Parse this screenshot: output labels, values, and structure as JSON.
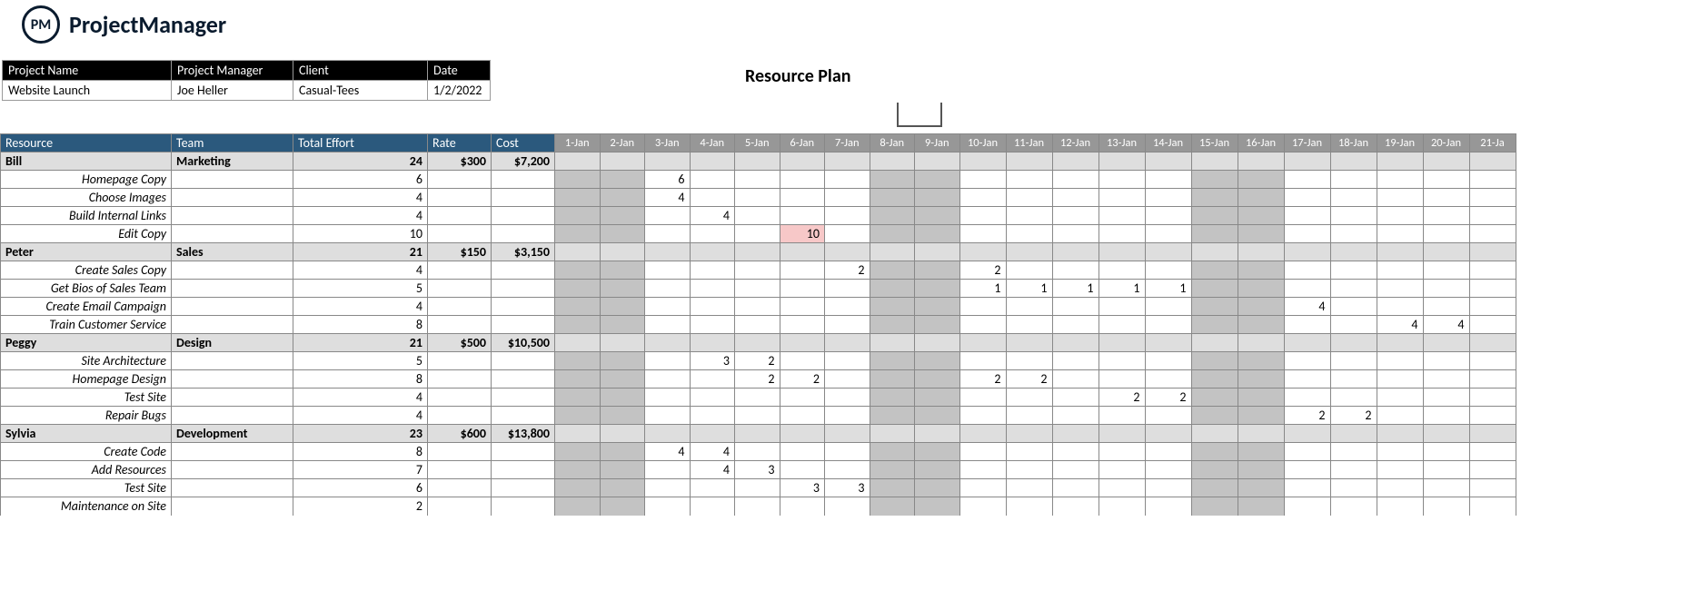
{
  "brand": {
    "short": "PM",
    "name": "ProjectManager"
  },
  "title": "Resource Plan",
  "meta": {
    "headers": [
      "Project Name",
      "Project Manager",
      "Client",
      "Date"
    ],
    "values": [
      "Website Launch",
      "Joe Heller",
      "Casual-Tees",
      "1/2/2022"
    ]
  },
  "columns_left": [
    "Resource",
    "Team",
    "Total Effort",
    "Rate",
    "Cost"
  ],
  "dates": [
    "1-Jan",
    "2-Jan",
    "3-Jan",
    "4-Jan",
    "5-Jan",
    "6-Jan",
    "7-Jan",
    "8-Jan",
    "9-Jan",
    "10-Jan",
    "11-Jan",
    "12-Jan",
    "13-Jan",
    "14-Jan",
    "15-Jan",
    "16-Jan",
    "17-Jan",
    "18-Jan",
    "19-Jan",
    "20-Jan",
    "21-Ja"
  ],
  "weekend_cols": [
    0,
    1,
    7,
    8,
    14,
    15
  ],
  "groups": [
    {
      "resource": "Bill",
      "team": "Marketing",
      "effort": "24",
      "rate": "$300",
      "cost": "$7,200",
      "tasks": [
        {
          "name": "Homepage Copy",
          "effort": "6",
          "cells": {
            "2": "6"
          }
        },
        {
          "name": "Choose Images",
          "effort": "4",
          "cells": {
            "2": "4"
          }
        },
        {
          "name": "Build Internal Links",
          "effort": "4",
          "cells": {
            "3": "4"
          }
        },
        {
          "name": "Edit Copy",
          "effort": "10",
          "cells": {
            "5": "10"
          },
          "warn": [
            5
          ]
        }
      ]
    },
    {
      "resource": "Peter",
      "team": "Sales",
      "effort": "21",
      "rate": "$150",
      "cost": "$3,150",
      "tasks": [
        {
          "name": "Create Sales Copy",
          "effort": "4",
          "cells": {
            "6": "2",
            "9": "2"
          }
        },
        {
          "name": "Get Bios of Sales Team",
          "effort": "5",
          "cells": {
            "9": "1",
            "10": "1",
            "11": "1",
            "12": "1",
            "13": "1"
          }
        },
        {
          "name": "Create Email Campaign",
          "effort": "4",
          "cells": {
            "16": "4"
          }
        },
        {
          "name": "Train Customer Service",
          "effort": "8",
          "cells": {
            "18": "4",
            "19": "4"
          }
        }
      ]
    },
    {
      "resource": "Peggy",
      "team": "Design",
      "effort": "21",
      "rate": "$500",
      "cost": "$10,500",
      "tasks": [
        {
          "name": "Site Architecture",
          "effort": "5",
          "cells": {
            "3": "3",
            "4": "2"
          }
        },
        {
          "name": "Homepage Design",
          "effort": "8",
          "cells": {
            "4": "2",
            "5": "2",
            "9": "2",
            "10": "2"
          }
        },
        {
          "name": "Test Site",
          "effort": "4",
          "cells": {
            "12": "2",
            "13": "2"
          }
        },
        {
          "name": "Repair Bugs",
          "effort": "4",
          "cells": {
            "16": "2",
            "17": "2"
          }
        }
      ]
    },
    {
      "resource": "Sylvia",
      "team": "Development",
      "effort": "23",
      "rate": "$600",
      "cost": "$13,800",
      "tasks": [
        {
          "name": "Create Code",
          "effort": "8",
          "cells": {
            "2": "4",
            "3": "4"
          }
        },
        {
          "name": "Add Resources",
          "effort": "7",
          "cells": {
            "3": "4",
            "4": "3"
          }
        },
        {
          "name": "Test Site",
          "effort": "6",
          "cells": {
            "5": "3",
            "6": "3"
          }
        },
        {
          "name": "Maintenance on Site",
          "effort": "2",
          "cells": {}
        }
      ]
    }
  ]
}
